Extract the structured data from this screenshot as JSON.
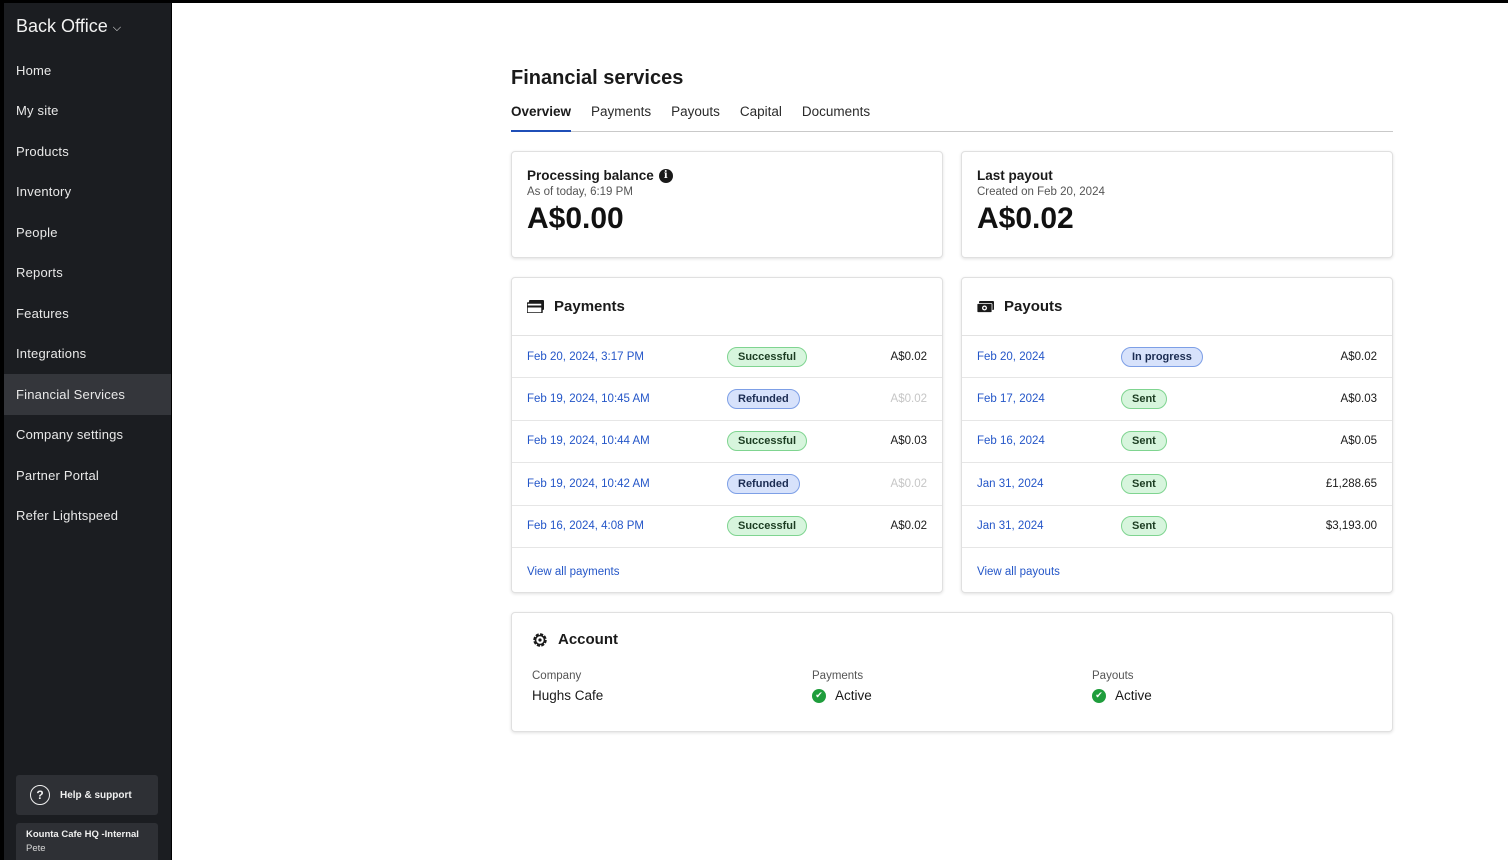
{
  "sidebar": {
    "brand": "Back Office",
    "items": [
      {
        "label": "Home"
      },
      {
        "label": "My site"
      },
      {
        "label": "Products"
      },
      {
        "label": "Inventory"
      },
      {
        "label": "People"
      },
      {
        "label": "Reports"
      },
      {
        "label": "Features"
      },
      {
        "label": "Integrations"
      },
      {
        "label": "Financial Services",
        "active": true
      },
      {
        "label": "Company settings"
      },
      {
        "label": "Partner Portal"
      },
      {
        "label": "Refer Lightspeed"
      }
    ],
    "help_label": "Help & support",
    "account": {
      "company": "Kounta Cafe HQ -Internal ",
      "user": "Pete"
    }
  },
  "page": {
    "title": "Financial services",
    "tabs": [
      {
        "label": "Overview",
        "active": true
      },
      {
        "label": "Payments"
      },
      {
        "label": "Payouts"
      },
      {
        "label": "Capital"
      },
      {
        "label": "Documents"
      }
    ]
  },
  "processing_balance": {
    "title": "Processing balance",
    "subtitle": "As of today, 6:19 PM",
    "amount": "A$0.00"
  },
  "last_payout": {
    "title": "Last payout",
    "subtitle": "Created on Feb 20, 2024",
    "amount": "A$0.02"
  },
  "payments": {
    "title": "Payments",
    "rows": [
      {
        "date": "Feb 20, 2024, 3:17 PM",
        "status": "Successful",
        "amount": "A$0.02"
      },
      {
        "date": "Feb 19, 2024, 10:45 AM",
        "status": "Refunded",
        "amount": "A$0.02"
      },
      {
        "date": "Feb 19, 2024, 10:44 AM",
        "status": "Successful",
        "amount": "A$0.03"
      },
      {
        "date": "Feb 19, 2024, 10:42 AM",
        "status": "Refunded",
        "amount": "A$0.02"
      },
      {
        "date": "Feb 16, 2024, 4:08 PM",
        "status": "Successful",
        "amount": "A$0.02"
      }
    ],
    "view_all": "View all payments"
  },
  "payouts": {
    "title": "Payouts",
    "rows": [
      {
        "date": "Feb 20, 2024",
        "status": "In progress",
        "amount": "A$0.02"
      },
      {
        "date": "Feb 17, 2024",
        "status": "Sent",
        "amount": "A$0.03"
      },
      {
        "date": "Feb 16, 2024",
        "status": "Sent",
        "amount": "A$0.05"
      },
      {
        "date": "Jan 31, 2024",
        "status": "Sent",
        "amount": "£1,288.65"
      },
      {
        "date": "Jan 31, 2024",
        "status": "Sent",
        "amount": "$3,193.00"
      }
    ],
    "view_all": "View all payouts"
  },
  "account": {
    "title": "Account",
    "company_label": "Company",
    "company_value": "Hughs Cafe",
    "payments_label": "Payments",
    "payments_value": "Active",
    "payouts_label": "Payouts",
    "payouts_value": "Active"
  },
  "colors": {
    "success_badge": "#d7f5dd",
    "info_badge": "#d7e2fb",
    "link": "#2456c8",
    "sidebar_bg": "#1b1d21"
  }
}
